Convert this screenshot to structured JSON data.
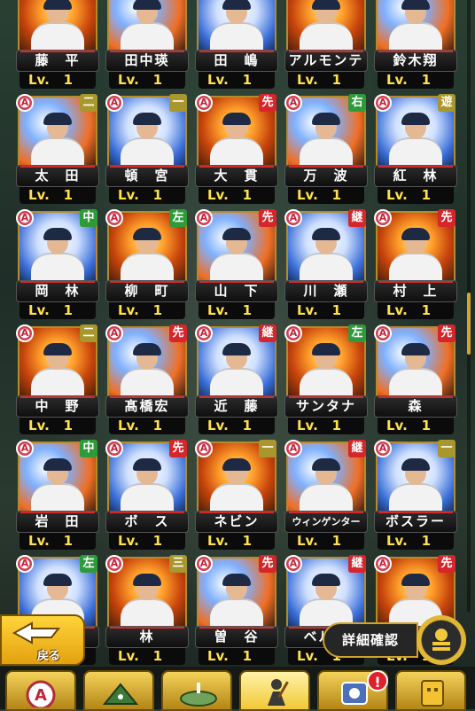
{
  "level_label": "Lv.",
  "cards": [
    {
      "name": "藤　平",
      "position": "",
      "level": "1"
    },
    {
      "name": "田中瑛",
      "position": "",
      "level": "1"
    },
    {
      "name": "田　嶋",
      "position": "",
      "level": "1"
    },
    {
      "name": "アルモンテ",
      "position": "",
      "level": "1"
    },
    {
      "name": "鈴木翔",
      "position": "",
      "level": "1"
    },
    {
      "name": "太　田",
      "position": "二",
      "level": "1"
    },
    {
      "name": "頓　宮",
      "position": "一",
      "level": "1"
    },
    {
      "name": "大　貫",
      "position": "先",
      "level": "1"
    },
    {
      "name": "万　波",
      "position": "右",
      "level": "1"
    },
    {
      "name": "紅　林",
      "position": "遊",
      "level": "1"
    },
    {
      "name": "岡　林",
      "position": "中",
      "level": "1"
    },
    {
      "name": "柳　町",
      "position": "左",
      "level": "1"
    },
    {
      "name": "山　下",
      "position": "先",
      "level": "1"
    },
    {
      "name": "川　瀬",
      "position": "継",
      "level": "1"
    },
    {
      "name": "村　上",
      "position": "先",
      "level": "1"
    },
    {
      "name": "中　野",
      "position": "二",
      "level": "1"
    },
    {
      "name": "髙橋宏",
      "position": "先",
      "level": "1"
    },
    {
      "name": "近　藤",
      "position": "継",
      "level": "1"
    },
    {
      "name": "サンタナ",
      "position": "左",
      "level": "1"
    },
    {
      "name": "森",
      "position": "先",
      "level": "1"
    },
    {
      "name": "岩　田",
      "position": "中",
      "level": "1"
    },
    {
      "name": "ボ　ス",
      "position": "先",
      "level": "1"
    },
    {
      "name": "ネビン",
      "position": "一",
      "level": "1"
    },
    {
      "name": "ウィンゲンター",
      "position": "継",
      "level": "1"
    },
    {
      "name": "ボスラー",
      "position": "一",
      "level": "1"
    },
    {
      "name": "",
      "position": "左",
      "level": "1"
    },
    {
      "name": "林",
      "position": "三",
      "level": "1"
    },
    {
      "name": "曽　谷",
      "position": "先",
      "level": "1"
    },
    {
      "name": "ベルド",
      "position": "継",
      "level": "1"
    },
    {
      "name": "",
      "position": "先",
      "level": "1"
    }
  ],
  "rank_badge": "A",
  "back_button": "戻る",
  "detail_button": "詳細確認",
  "tab_alert": "!",
  "tabs": [
    {
      "icon": "a-rank-icon"
    },
    {
      "icon": "stadium-icon"
    },
    {
      "icon": "field-icon"
    },
    {
      "icon": "batter-icon"
    },
    {
      "icon": "trophy-icon"
    },
    {
      "icon": "box-icon"
    }
  ],
  "colors": {
    "position_green": "#2f9a3a",
    "position_red": "#d4262b",
    "position_olive": "#a8972d",
    "level_text": "#ffe24a",
    "accent_gold": "#d0a22e"
  }
}
